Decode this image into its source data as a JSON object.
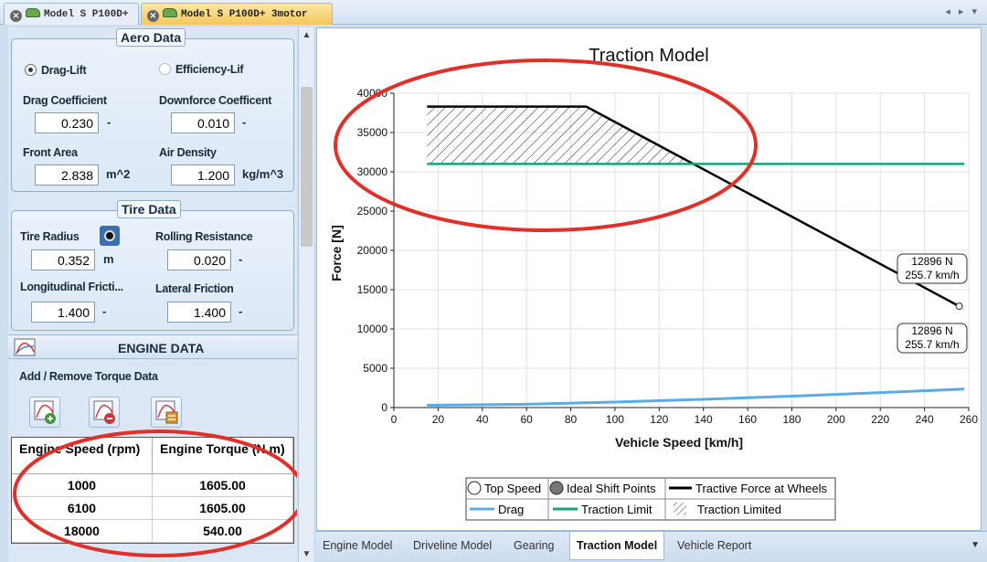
{
  "doc_tabs": [
    {
      "label": "Model S P100D+"
    },
    {
      "label": "Model S P100D+ 3motor"
    }
  ],
  "aero": {
    "title": "Aero Data",
    "mode_options": [
      "Drag-Lift",
      "Efficiency-Lif"
    ],
    "selected_mode": "Drag-Lift",
    "drag_coefficient": {
      "label": "Drag Coefficient",
      "value": "0.230",
      "unit": "-"
    },
    "downforce_coefficient": {
      "label": "Downforce Coefficent",
      "value": "0.010",
      "unit": "-"
    },
    "front_area": {
      "label": "Front Area",
      "value": "2.838",
      "unit": "m^2"
    },
    "air_density": {
      "label": "Air Density",
      "value": "1.200",
      "unit": "kg/m^3"
    }
  },
  "tire": {
    "title": "Tire Data",
    "tire_radius": {
      "label": "Tire Radius",
      "value": "0.352",
      "unit": "m"
    },
    "rolling_resistance": {
      "label": "Rolling Resistance",
      "value": "0.020",
      "unit": "-"
    },
    "longitudinal_friction": {
      "label": "Longitudinal Fricti...",
      "value": "1.400",
      "unit": "-"
    },
    "lateral_friction": {
      "label": "Lateral Friction",
      "value": "1.400",
      "unit": "-"
    }
  },
  "engine": {
    "title": "ENGINE DATA",
    "add_remove_label": "Add / Remove Torque Data",
    "columns": [
      "Engine Speed (rpm)",
      "Engine Torque (N.m)"
    ],
    "rows": [
      [
        "1000",
        "1605.00"
      ],
      [
        "6100",
        "1605.00"
      ],
      [
        "18000",
        "540.00"
      ]
    ]
  },
  "bottom_tabs": [
    "Engine Model",
    "Driveline Model",
    "Gearing",
    "Traction Model",
    "Vehicle Report"
  ],
  "active_bottom_tab": "Traction Model",
  "colors": {
    "tractive": "#000000",
    "traction_limit": "#14a37a",
    "drag": "#5aace6",
    "highlight": "#e0302a"
  },
  "chart_data": {
    "type": "line",
    "title": "Traction Model",
    "xlabel": "Vehicle Speed [km/h]",
    "ylabel": "Force [N]",
    "xlim": [
      0,
      260
    ],
    "ylim": [
      0,
      40000
    ],
    "xticks": [
      0,
      20,
      40,
      60,
      80,
      100,
      120,
      140,
      160,
      180,
      200,
      220,
      240,
      260
    ],
    "yticks": [
      0,
      5000,
      10000,
      15000,
      20000,
      25000,
      30000,
      35000,
      40000
    ],
    "series": [
      {
        "name": "Tractive Force at Wheels",
        "color": "#000000",
        "x": [
          15,
          87,
          255.7
        ],
        "y": [
          38300,
          38300,
          12896
        ]
      },
      {
        "name": "Traction Limit",
        "color": "#14a37a",
        "x": [
          15,
          258
        ],
        "y": [
          31000,
          31000
        ]
      },
      {
        "name": "Drag",
        "color": "#5aace6",
        "x": [
          15,
          60,
          100,
          140,
          180,
          220,
          258
        ],
        "y": [
          290,
          420,
          700,
          1050,
          1450,
          1900,
          2350
        ]
      }
    ],
    "hatched_region": {
      "name": "Traction Limited",
      "x_start": 15,
      "x_end": 130,
      "y_top": 38300,
      "y_bottom": 31000
    },
    "annotations": [
      {
        "lines": [
          "12896 N",
          "255.7 km/h"
        ]
      },
      {
        "lines": [
          "12896 N",
          "255.7 km/h"
        ]
      }
    ],
    "top_speed_point": {
      "x": 255.7,
      "y": 12896
    },
    "legend": [
      [
        "Top Speed",
        "Ideal Shift Points",
        "Tractive Force at Wheels"
      ],
      [
        "Drag",
        "Traction Limit",
        "Traction Limited"
      ]
    ],
    "legend_position": "bottom"
  }
}
